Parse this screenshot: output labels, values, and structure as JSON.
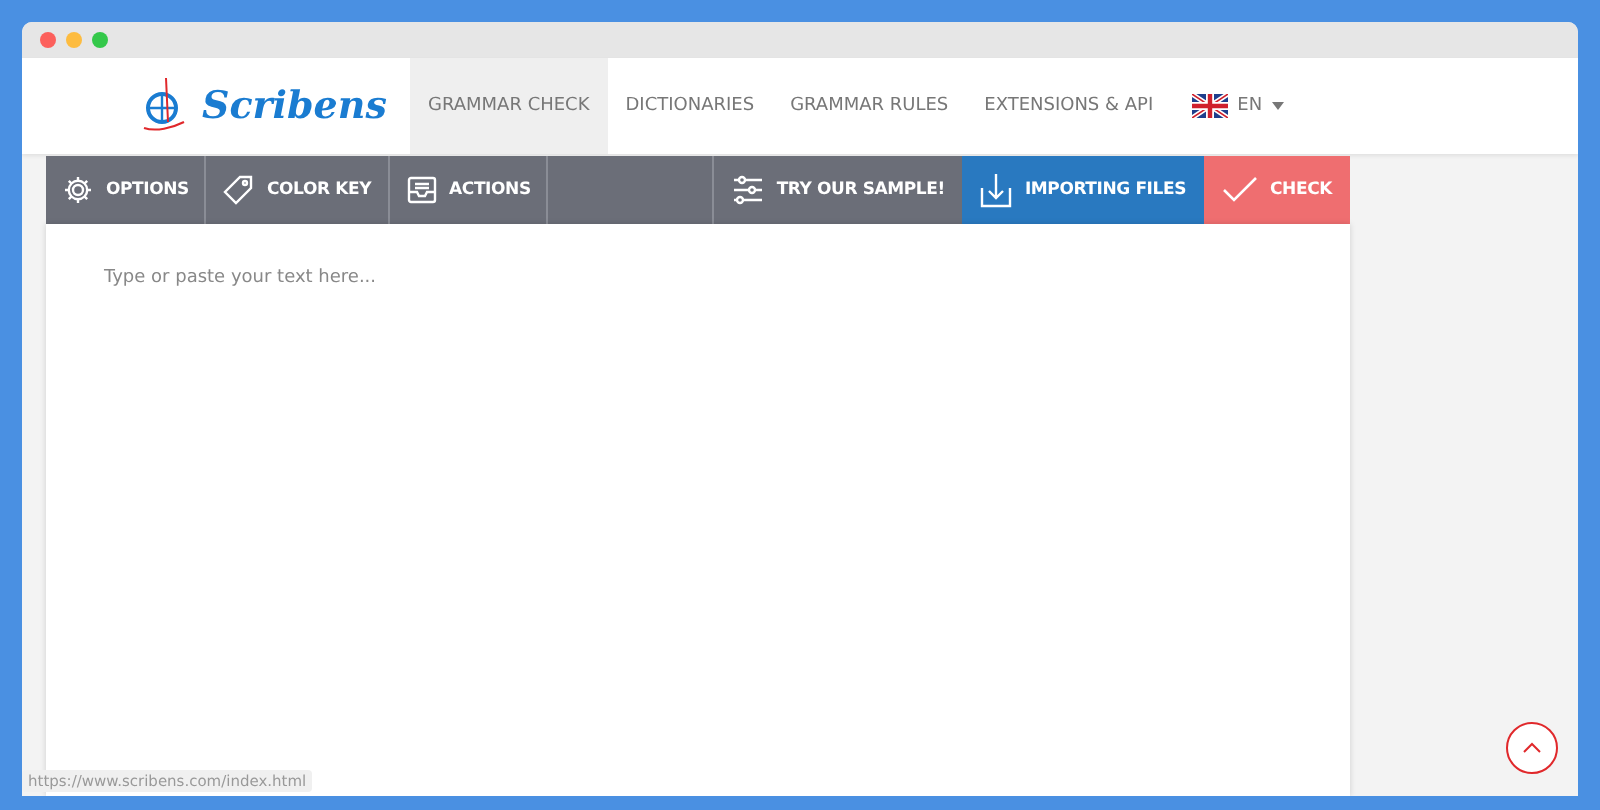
{
  "brand": {
    "name": "Scribens"
  },
  "nav": [
    {
      "label": "GRAMMAR CHECK",
      "selected": true
    },
    {
      "label": "DICTIONARIES",
      "selected": false
    },
    {
      "label": "GRAMMAR RULES",
      "selected": false
    },
    {
      "label": "EXTENSIONS & API",
      "selected": false
    }
  ],
  "language": {
    "label": "EN"
  },
  "toolbar": {
    "left": [
      {
        "label": "OPTIONS"
      },
      {
        "label": "COLOR KEY"
      },
      {
        "label": "ACTIONS"
      }
    ],
    "right": [
      {
        "label": "TRY OUR SAMPLE!",
        "kind": "plain"
      },
      {
        "label": "IMPORTING FILES",
        "kind": "primary"
      },
      {
        "label": "CHECK",
        "kind": "danger"
      }
    ]
  },
  "editor": {
    "placeholder": "Type or paste your text here..."
  },
  "status_url": "https://www.scribens.com/index.html"
}
